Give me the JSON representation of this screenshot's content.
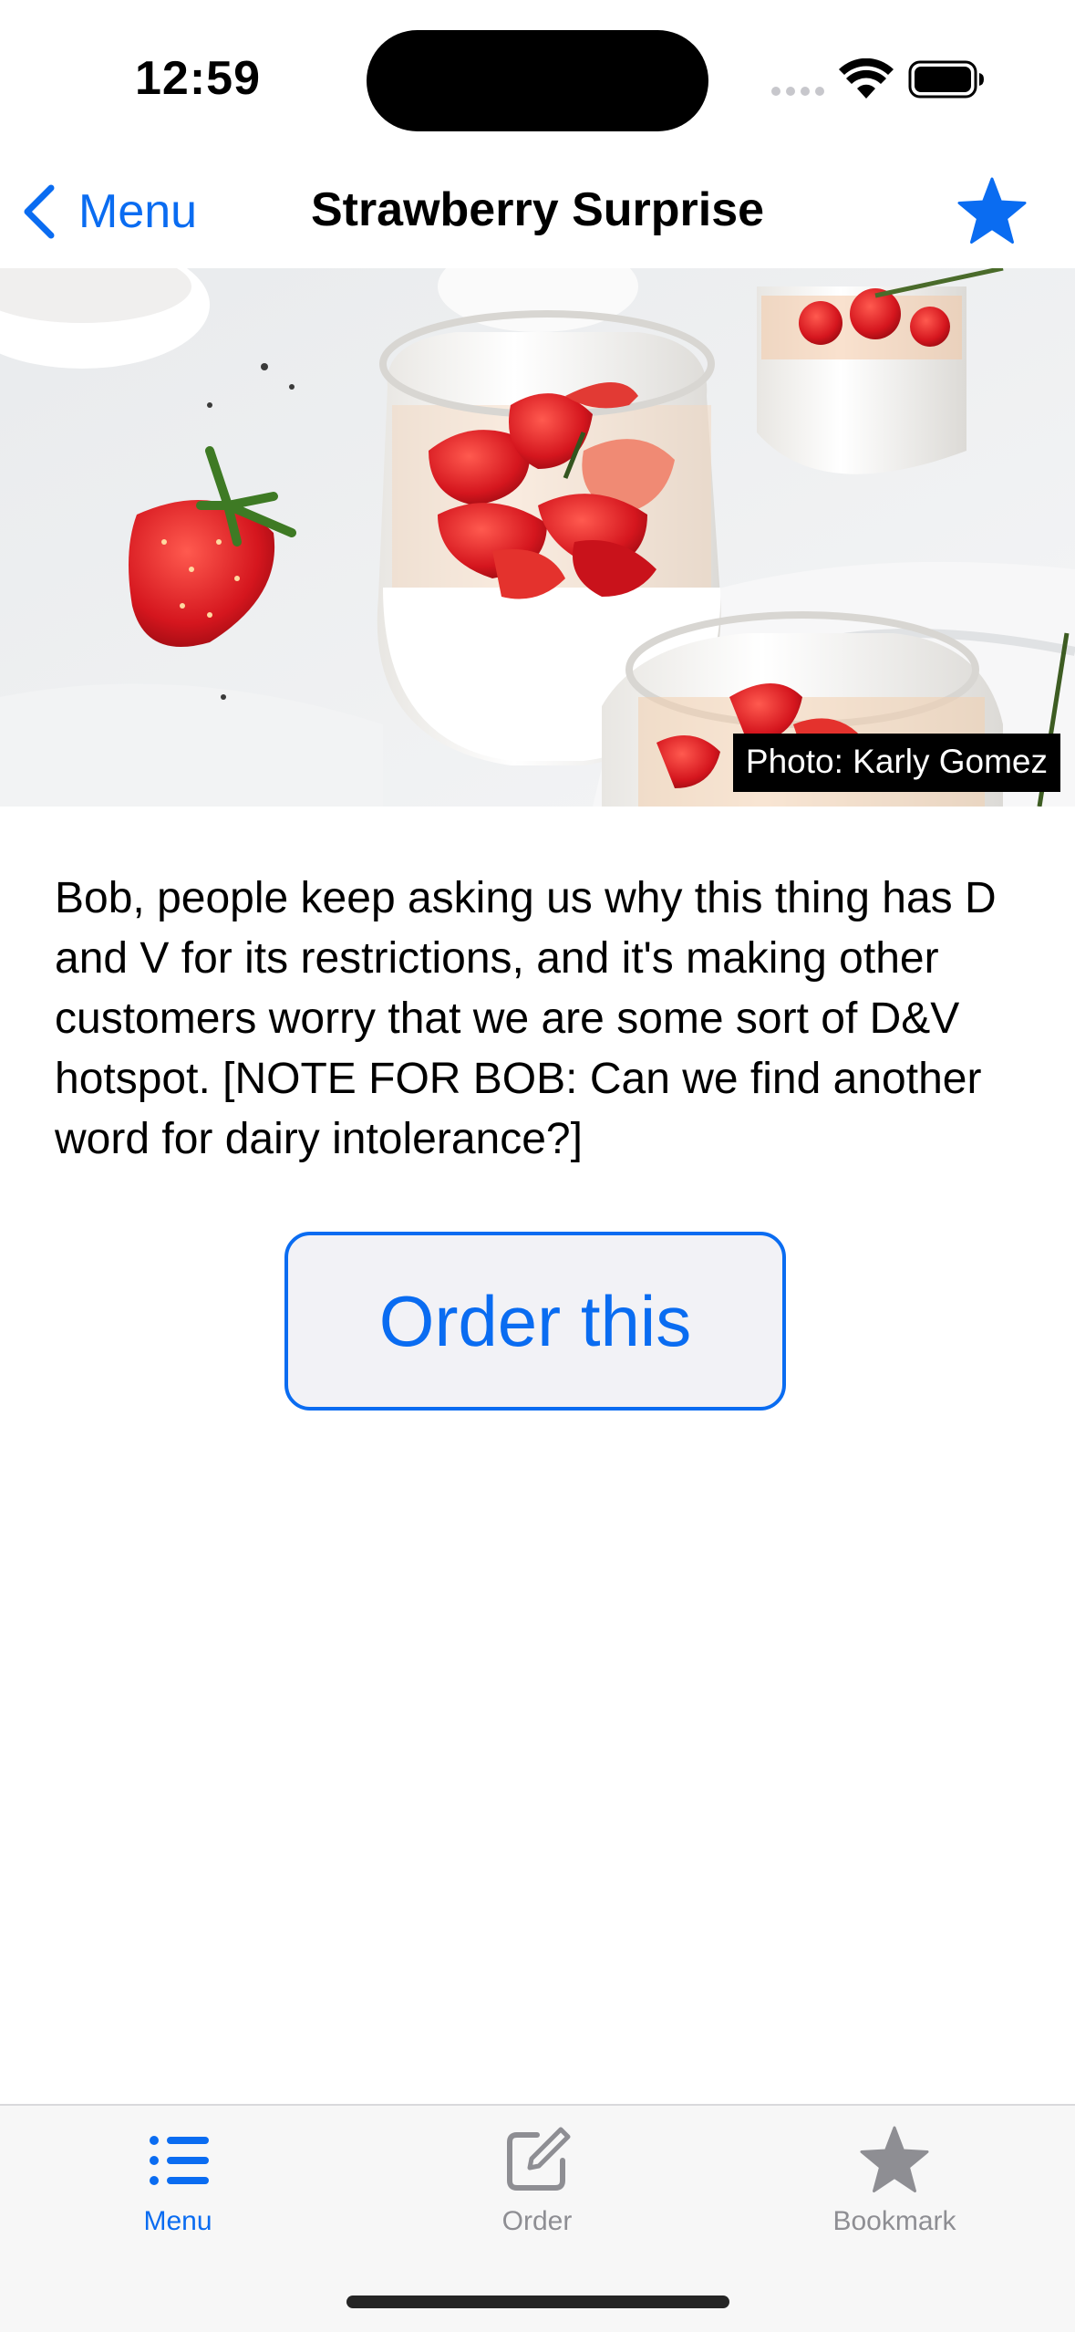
{
  "status_bar": {
    "time": "12:59"
  },
  "nav": {
    "back_label": "Menu",
    "title": "Strawberry Surprise",
    "bookmark_icon": "star-fill-icon"
  },
  "hero": {
    "photo_credit": "Photo: Karly Gomez"
  },
  "description": "Bob, people keep asking us why this thing has D and V for its restrictions, and it's making other customers worry that we are some sort of D&V hotspot. [NOTE FOR BOB: Can we find another word for dairy intolerance?]",
  "order_button_label": "Order this",
  "tab_bar": {
    "items": [
      {
        "label": "Menu",
        "icon": "list-icon",
        "selected": true
      },
      {
        "label": "Order",
        "icon": "compose-icon",
        "selected": false
      },
      {
        "label": "Bookmark",
        "icon": "star-icon",
        "selected": false
      }
    ]
  },
  "colors": {
    "accent": "#0a6cf1",
    "inactive": "#8e8e93",
    "tab_bar_bg": "#f7f7f7"
  }
}
